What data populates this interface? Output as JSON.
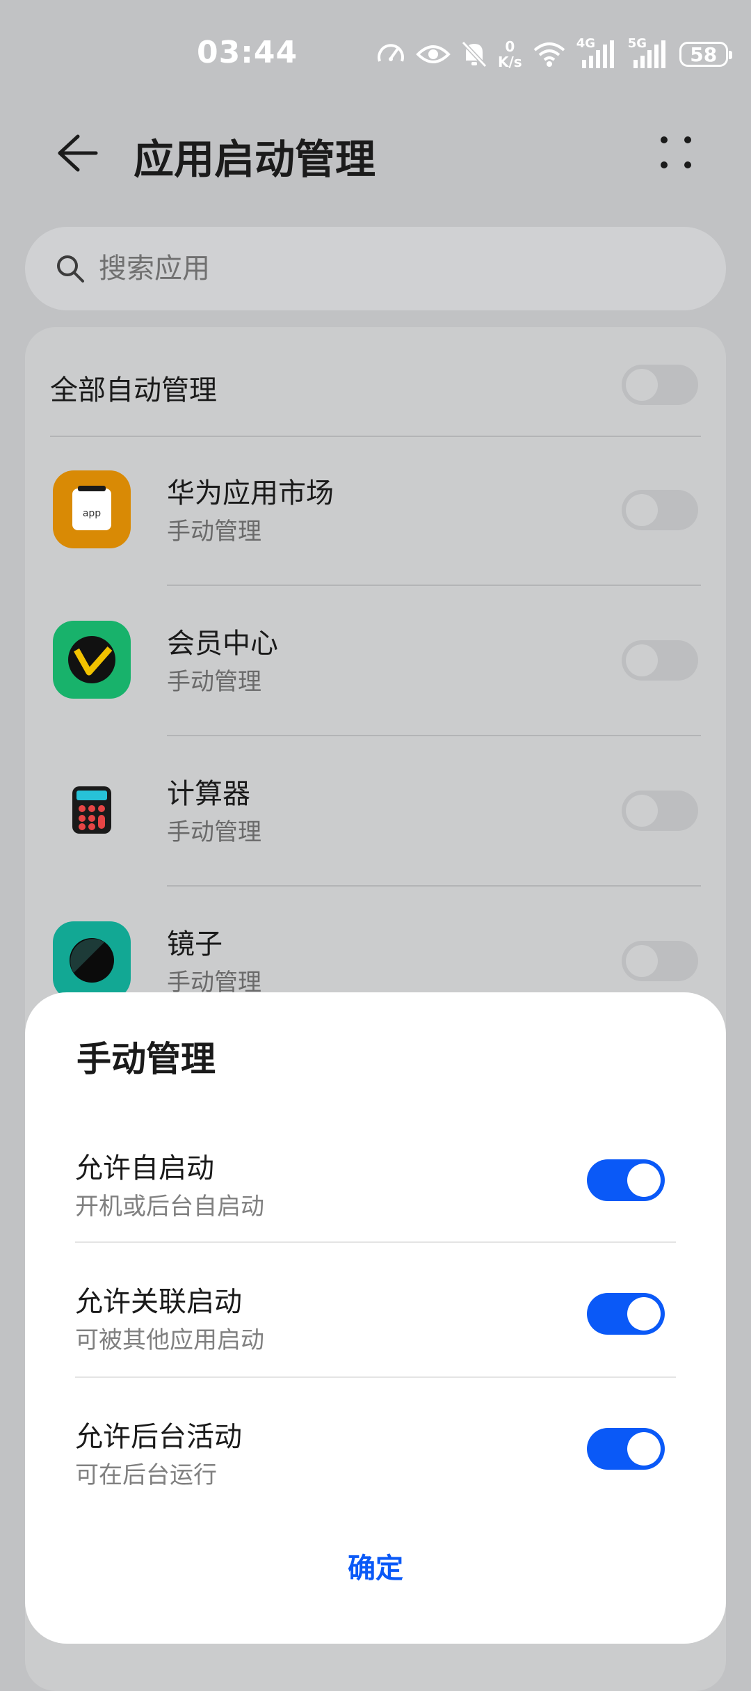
{
  "status_bar": {
    "time": "03:44",
    "speed_value": "0",
    "speed_unit": "K/s",
    "net1": "4G",
    "net2": "5G",
    "battery": "58",
    "icons": [
      "speed-icon",
      "eye-icon",
      "bell-off-icon",
      "wifi-icon",
      "signal-icon",
      "signal-icon",
      "battery-icon"
    ]
  },
  "header": {
    "title": "应用启动管理"
  },
  "search": {
    "placeholder": "搜索应用"
  },
  "list": {
    "all_label": "全部自动管理",
    "apps": [
      {
        "name": "华为应用市场",
        "status": "手动管理",
        "icon": "app-market-icon"
      },
      {
        "name": "会员中心",
        "status": "手动管理",
        "icon": "member-center-icon"
      },
      {
        "name": "计算器",
        "status": "手动管理",
        "icon": "calculator-icon"
      },
      {
        "name": "镜子",
        "status": "手动管理",
        "icon": "mirror-icon"
      }
    ]
  },
  "sheet": {
    "title": "手动管理",
    "options": [
      {
        "label": "允许自启动",
        "sub": "开机或后台自启动",
        "enabled": true
      },
      {
        "label": "允许关联启动",
        "sub": "可被其他应用启动",
        "enabled": true
      },
      {
        "label": "允许后台活动",
        "sub": "可在后台运行",
        "enabled": true
      }
    ],
    "confirm": "确定"
  },
  "colors": {
    "accent": "#0a59f7",
    "scrim_bg": "#c1c2c4"
  }
}
